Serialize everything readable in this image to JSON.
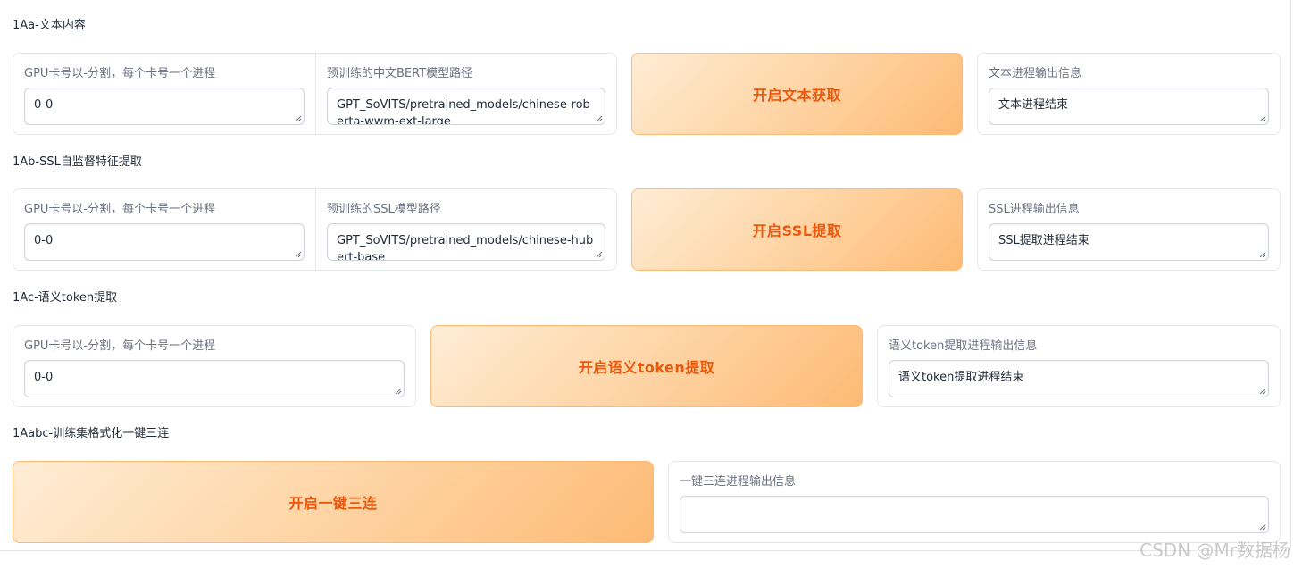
{
  "sections": [
    {
      "title": "1Aa-文本内容",
      "gpu_label": "GPU卡号以-分割，每个卡号一个进程",
      "gpu_value": "0-0",
      "model_label": "预训练的中文BERT模型路径",
      "model_value": "GPT_SoVITS/pretrained_models/chinese-roberta-wwm-ext-large",
      "button_label": "开启文本获取",
      "output_label": "文本进程输出信息",
      "output_value": "文本进程结束"
    },
    {
      "title": "1Ab-SSL自监督特征提取",
      "gpu_label": "GPU卡号以-分割，每个卡号一个进程",
      "gpu_value": "0-0",
      "model_label": "预训练的SSL模型路径",
      "model_value": "GPT_SoVITS/pretrained_models/chinese-hubert-base",
      "button_label": "开启SSL提取",
      "output_label": "SSL进程输出信息",
      "output_value": "SSL提取进程结束"
    },
    {
      "title": "1Ac-语义token提取",
      "gpu_label": "GPU卡号以-分割，每个卡号一个进程",
      "gpu_value": "0-0",
      "button_label": "开启语义token提取",
      "output_label": "语义token提取进程输出信息",
      "output_value": "语义token提取进程结束"
    },
    {
      "title": "1Aabc-训练集格式化一键三连",
      "button_label": "开启一键三连",
      "output_label": "一键三连进程输出信息",
      "output_value": ""
    }
  ],
  "watermark": "CSDN @Mr数据杨",
  "colors": {
    "button_text": "#ea580c",
    "button_gradient_start": "#ffedd5",
    "button_gradient_end": "#fdba74"
  }
}
